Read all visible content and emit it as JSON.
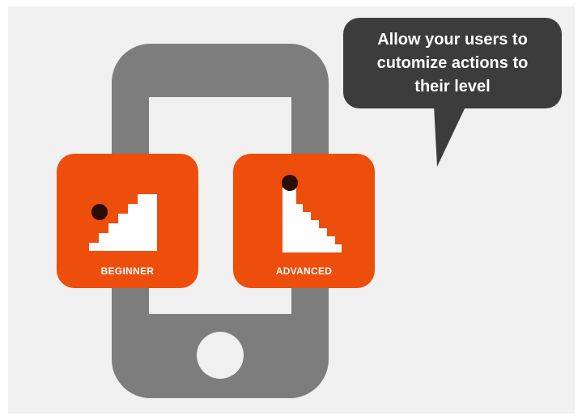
{
  "callout": {
    "lines": [
      "Allow your users to",
      "cutomize actions to",
      "their level"
    ]
  },
  "tiles": {
    "beginner": {
      "label": "BEGINNER",
      "icon": "stairs-ascending-icon"
    },
    "advanced": {
      "label": "ADVANCED",
      "icon": "stairs-descending-icon"
    }
  },
  "colors": {
    "accent": "#ee4e0c",
    "phone": "#7d7d7d",
    "bubble": "#3c3c3c",
    "background": "#f0f0f0",
    "dot": "#2a0d05"
  }
}
